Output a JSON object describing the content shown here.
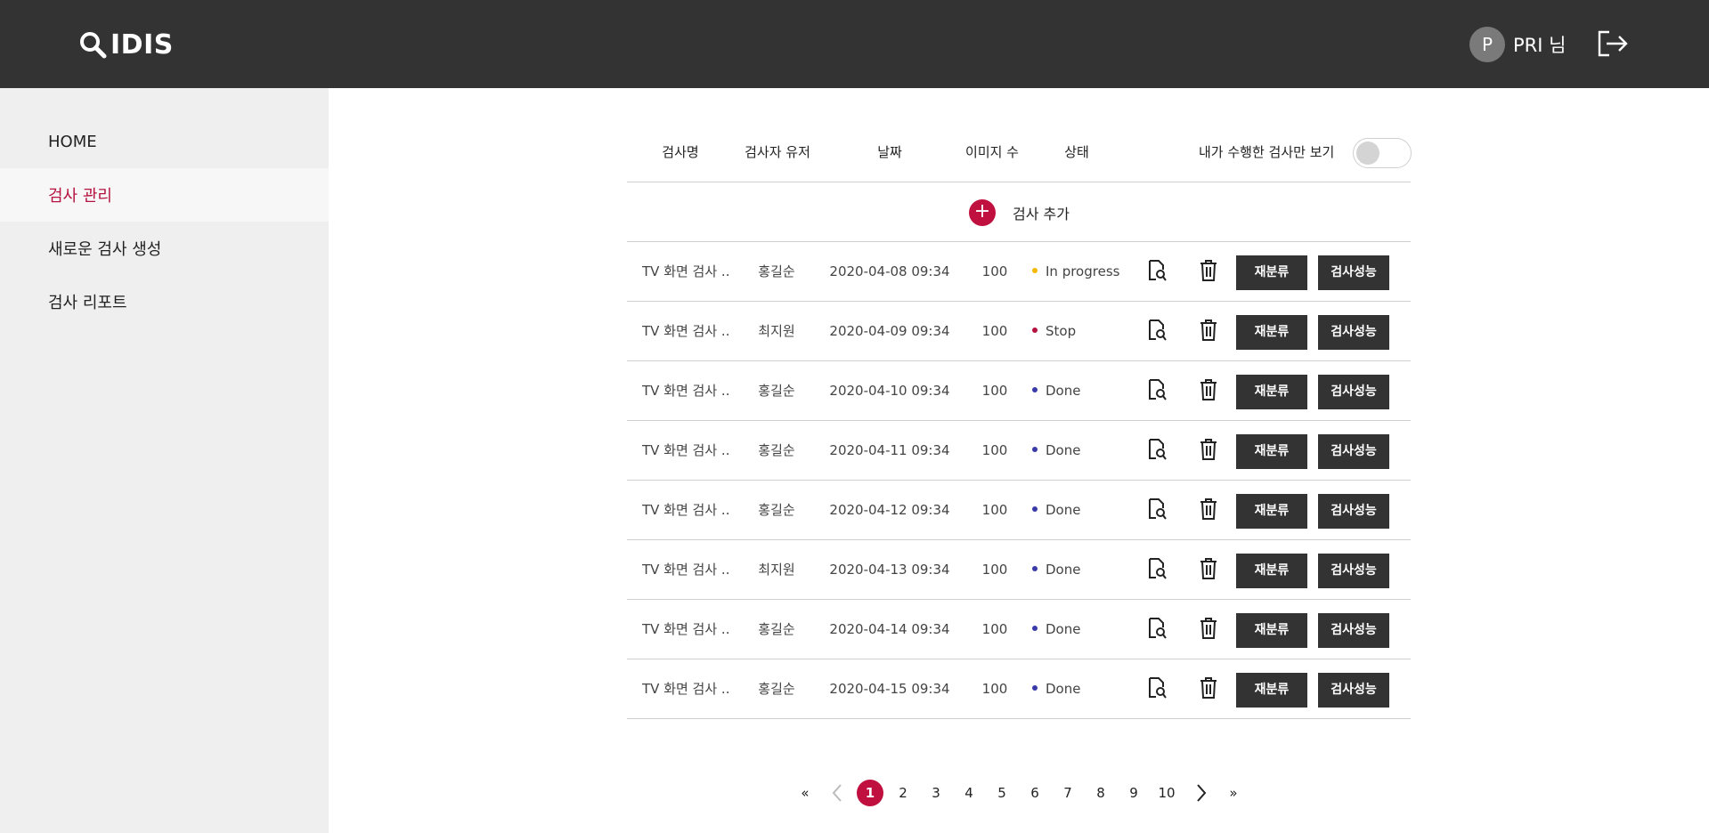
{
  "header": {
    "logo_text": "IDIS",
    "user_initial": "P",
    "user_name": "PRI 님"
  },
  "sidebar": {
    "items": [
      {
        "label": "HOME"
      },
      {
        "label": "검사 관리"
      },
      {
        "label": "새로운 검사 생성"
      },
      {
        "label": "검사 리포트"
      }
    ]
  },
  "table": {
    "headers": [
      "검사명",
      "검사자 유저",
      "날짜",
      "이미지 수",
      "상태"
    ],
    "toggle_label": "내가 수행한 검사만 보기",
    "add_label": "검사 추가",
    "rows": [
      {
        "name": "TV 화면 검사 ...",
        "user": "홍길순",
        "date": "2020-04-08 09:34",
        "count": "100",
        "status": "In progress",
        "status_color": "#f5b800",
        "reclass": "재분류",
        "perf": "검사성능"
      },
      {
        "name": "TV 화면 검사 ...",
        "user": "최지원",
        "date": "2020-04-09 09:34",
        "count": "100",
        "status": "Stop",
        "status_color": "#b5123f",
        "reclass": "재분류",
        "perf": "검사성능"
      },
      {
        "name": "TV 화면 검사 ...",
        "user": "홍길순",
        "date": "2020-04-10 09:34",
        "count": "100",
        "status": "Done",
        "status_color": "#3a3aa8",
        "reclass": "재분류",
        "perf": "검사성능"
      },
      {
        "name": "TV 화면 검사 ...",
        "user": "홍길순",
        "date": "2020-04-11 09:34",
        "count": "100",
        "status": "Done",
        "status_color": "#3a3aa8",
        "reclass": "재분류",
        "perf": "검사성능"
      },
      {
        "name": "TV 화면 검사 ...",
        "user": "홍길순",
        "date": "2020-04-12 09:34",
        "count": "100",
        "status": "Done",
        "status_color": "#3a3aa8",
        "reclass": "재분류",
        "perf": "검사성능"
      },
      {
        "name": "TV 화면 검사 ...",
        "user": "최지원",
        "date": "2020-04-13 09:34",
        "count": "100",
        "status": "Done",
        "status_color": "#3a3aa8",
        "reclass": "재분류",
        "perf": "검사성능"
      },
      {
        "name": "TV 화면 검사 ...",
        "user": "홍길순",
        "date": "2020-04-14 09:34",
        "count": "100",
        "status": "Done",
        "status_color": "#3a3aa8",
        "reclass": "재분류",
        "perf": "검사성능"
      },
      {
        "name": "TV 화면 검사 ...",
        "user": "홍길순",
        "date": "2020-04-15 09:34",
        "count": "100",
        "status": "Done",
        "status_color": "#3a3aa8",
        "reclass": "재분류",
        "perf": "검사성능"
      }
    ]
  },
  "pagination": {
    "first": "«",
    "last": "»",
    "pages": [
      "1",
      "2",
      "3",
      "4",
      "5",
      "6",
      "7",
      "8",
      "9",
      "10"
    ],
    "current": "1"
  },
  "colors": {
    "topbar": "#333333",
    "accent": "#c0103f",
    "sidebar": "#efefef"
  }
}
